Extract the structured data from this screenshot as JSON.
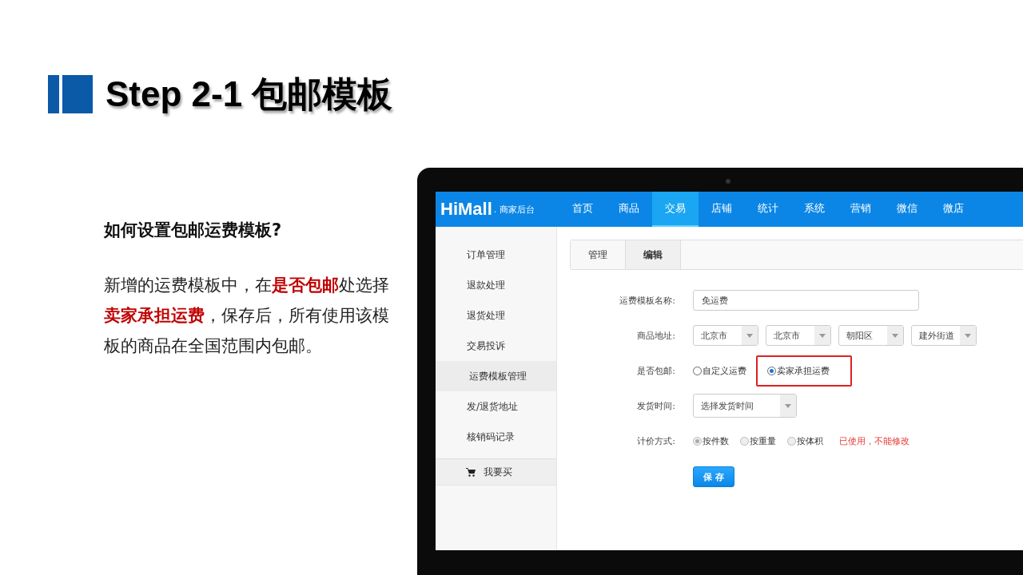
{
  "slide": {
    "title": "Step 2-1 包邮模板",
    "question": "如何设置包邮运费模板?",
    "paragraph": "新增的运费模板中，在**是否包邮**处选择**卖家承担运费**，保存后，所有使用该模板的商品在全国范围内包邮。"
  },
  "app": {
    "logo": "HiMall",
    "subtitle": ". 商家后台",
    "nav": [
      {
        "label": "首页",
        "selected": false
      },
      {
        "label": "商品",
        "selected": false
      },
      {
        "label": "交易",
        "selected": true
      },
      {
        "label": "店铺",
        "selected": false
      },
      {
        "label": "统计",
        "selected": false
      },
      {
        "label": "系统",
        "selected": false
      },
      {
        "label": "营销",
        "selected": false
      },
      {
        "label": "微信",
        "selected": false
      },
      {
        "label": "微店",
        "selected": false
      }
    ],
    "sidebar": {
      "items": [
        {
          "label": "订单管理",
          "selected": false
        },
        {
          "label": "退款处理",
          "selected": false
        },
        {
          "label": "退货处理",
          "selected": false
        },
        {
          "label": "交易投诉",
          "selected": false
        },
        {
          "label": "运费模板管理",
          "selected": true
        },
        {
          "label": "发/退货地址",
          "selected": false
        },
        {
          "label": "核销码记录",
          "selected": false
        }
      ],
      "buy_link": "我要买"
    },
    "tabs": [
      {
        "label": "管理",
        "selected": false
      },
      {
        "label": "编辑",
        "selected": true
      }
    ],
    "form": [
      {
        "kind": "text",
        "label": "运费模板名称:",
        "value": "免运费"
      },
      {
        "kind": "selects",
        "label": "商品地址:",
        "options": [
          {
            "value": "北京市"
          },
          {
            "value": "北京市"
          },
          {
            "value": "朝阳区"
          },
          {
            "value": "建外街道"
          }
        ]
      },
      {
        "kind": "radio",
        "label": "是否包邮:",
        "options": [
          {
            "label": "自定义运费",
            "selected": false,
            "highlighted": false,
            "disabled": false
          },
          {
            "label": "卖家承担运费",
            "selected": true,
            "highlighted": true,
            "disabled": false
          }
        ]
      },
      {
        "kind": "select",
        "label": "发货时间:",
        "placeholder": "选择发货时间"
      },
      {
        "kind": "radio",
        "label": "计价方式:",
        "options": [
          {
            "label": "按件数",
            "selected": true,
            "highlighted": false,
            "disabled": true
          },
          {
            "label": "按重量",
            "selected": false,
            "highlighted": false,
            "disabled": true
          },
          {
            "label": "按体积",
            "selected": false,
            "highlighted": false,
            "disabled": true
          }
        ],
        "note": "已使用，不能修改"
      }
    ],
    "save_button": "保 存"
  }
}
